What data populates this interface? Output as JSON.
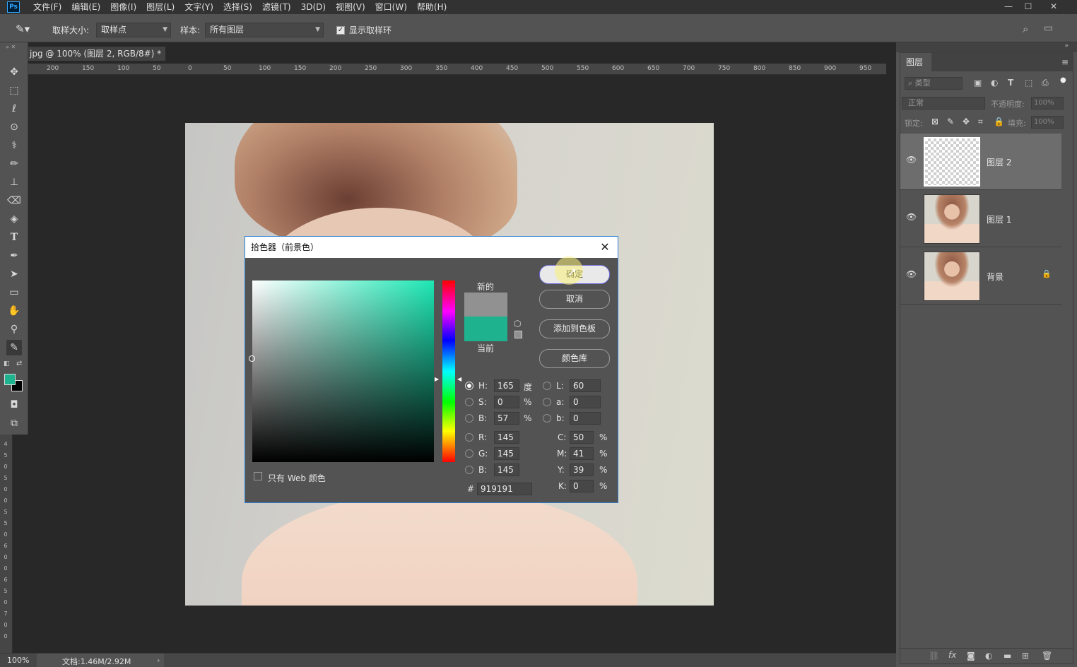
{
  "app": {
    "logo": "Ps"
  },
  "menu": [
    "文件(F)",
    "编辑(E)",
    "图像(I)",
    "图层(L)",
    "文字(Y)",
    "选择(S)",
    "滤镜(T)",
    "3D(D)",
    "视图(V)",
    "窗口(W)",
    "帮助(H)"
  ],
  "options_bar": {
    "sample_size_label": "取样大小:",
    "sample_size_value": "取样点",
    "sample_label": "样本:",
    "sample_value": "所有图层",
    "show_ring_label": "显示取样环",
    "show_ring_checked": true
  },
  "document": {
    "tab_title": "jpg @ 100% (图层 2, RGB/8#) *",
    "ruler_h_ticks": [
      "200",
      "150",
      "100",
      "50",
      "0",
      "50",
      "100",
      "150",
      "200",
      "250",
      "300",
      "350",
      "400",
      "450",
      "500",
      "550",
      "600",
      "650",
      "700",
      "750",
      "800",
      "850",
      "900",
      "950"
    ],
    "ruler_v_labels": [
      "4",
      "5",
      "0",
      "5",
      "0",
      "0",
      "5",
      "5",
      "0",
      "6",
      "0",
      "0",
      "6",
      "5",
      "0",
      "7",
      "0",
      "0"
    ]
  },
  "tools": {
    "foreground_color": "#1eb28f",
    "background_color": "#000000",
    "items": [
      "move-icon",
      "marquee-icon",
      "lasso-icon",
      "quick-select-icon",
      "healing-icon",
      "brush-icon",
      "stamp-icon",
      "eraser-icon",
      "paint-bucket-icon",
      "type-icon",
      "pen-icon",
      "path-select-icon",
      "rectangle-icon",
      "hand-icon",
      "zoom-icon",
      "eyedropper-icon"
    ]
  },
  "color_picker": {
    "title": "拾色器（前景色）",
    "new_label": "新的",
    "current_label": "当前",
    "new_color": "#919191",
    "current_color": "#1eb28f",
    "buttons": {
      "ok": "确定",
      "cancel": "取消",
      "add_swatch": "添加到色板",
      "libraries": "颜色库"
    },
    "web_only_label": "只有 Web 颜色",
    "hsb": {
      "h_label": "H:",
      "h": "165",
      "h_unit": "度",
      "s_label": "S:",
      "s": "0",
      "s_unit": "%",
      "b_label": "B:",
      "b": "57",
      "b_unit": "%"
    },
    "lab": {
      "l_label": "L:",
      "l": "60",
      "a_label": "a:",
      "a": "0",
      "b_label": "b:",
      "b": "0"
    },
    "rgb": {
      "r_label": "R:",
      "r": "145",
      "g_label": "G:",
      "g": "145",
      "b_label": "B:",
      "b": "145"
    },
    "cmyk": {
      "c_label": "C:",
      "c": "50",
      "m_label": "M:",
      "m": "41",
      "y_label": "Y:",
      "y": "39",
      "k_label": "K:",
      "k": "0",
      "unit": "%"
    },
    "hex_label": "#",
    "hex": "919191"
  },
  "layers_panel": {
    "tab": "图层",
    "filter_placeholder": "类型",
    "blend_mode": "正常",
    "opacity_label": "不透明度:",
    "opacity_value": "100%",
    "lock_label": "锁定:",
    "fill_label": "填充:",
    "fill_value": "100%",
    "layers": [
      {
        "name": "图层 2",
        "selected": true,
        "kind": "transparent"
      },
      {
        "name": "图层 1",
        "selected": false,
        "kind": "photo"
      },
      {
        "name": "背景",
        "selected": false,
        "kind": "photo",
        "locked": true
      }
    ]
  },
  "status": {
    "zoom": "100%",
    "doc_info": "文档:1.46M/2.92M"
  }
}
